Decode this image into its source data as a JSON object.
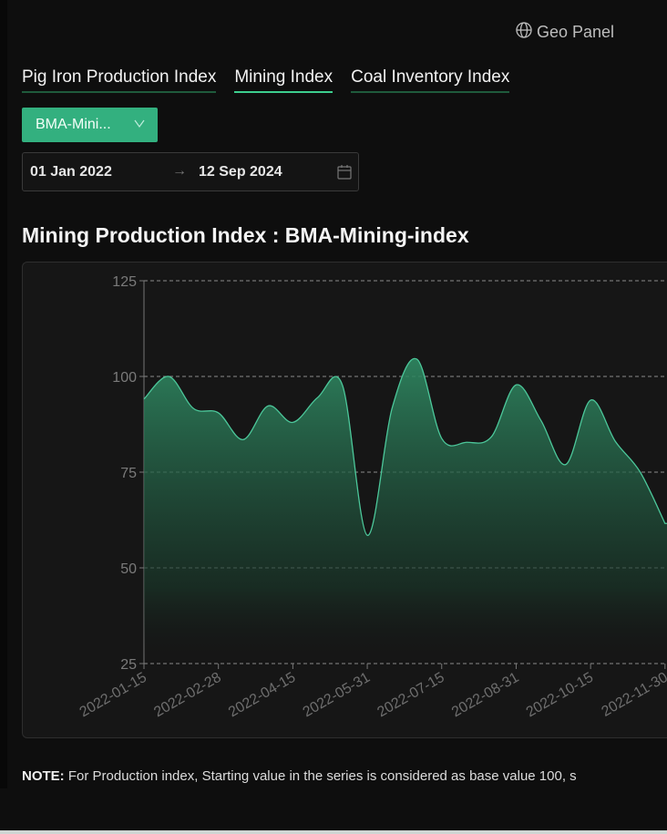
{
  "header": {
    "geo_panel_label": "Geo Panel",
    "geo_icon": "globe-icon"
  },
  "tabs": [
    {
      "label": "Pig Iron Production Index",
      "active": false
    },
    {
      "label": "Mining Index",
      "active": true
    },
    {
      "label": "Coal Inventory Index",
      "active": false
    }
  ],
  "index_select": {
    "value": "BMA-Mini...",
    "icon": "chevron-down-icon"
  },
  "date_range": {
    "start": "01 Jan 2022",
    "end": "12 Sep 2024",
    "separator": "→",
    "icon": "calendar-icon"
  },
  "chart_title": "Mining Production Index : BMA-Mining-index",
  "colors": {
    "accent": "#33b07f",
    "line": "#4cc79a",
    "tab_active": "#3dcf8e",
    "panel_bg": "#161616"
  },
  "chart_data": {
    "type": "area",
    "x": [
      "2022-01-15",
      "2022-01-31",
      "2022-02-15",
      "2022-02-28",
      "2022-03-15",
      "2022-03-31",
      "2022-04-15",
      "2022-04-30",
      "2022-05-15",
      "2022-05-31",
      "2022-06-15",
      "2022-06-30",
      "2022-07-15",
      "2022-07-31",
      "2022-08-15",
      "2022-08-31",
      "2022-09-15",
      "2022-09-30",
      "2022-10-15",
      "2022-10-31",
      "2022-11-15",
      "2022-11-30"
    ],
    "values": [
      94.1,
      100,
      91.6,
      90.5,
      83.5,
      92.3,
      88,
      94.5,
      97.7,
      58.5,
      91.7,
      104.5,
      83.8,
      82.8,
      84.2,
      97.8,
      88.5,
      77,
      93.8,
      83,
      75,
      61.6
    ],
    "x_ticks": [
      "2022-01-15",
      "2022-02-28",
      "2022-04-15",
      "2022-05-31",
      "2022-07-15",
      "2022-08-31",
      "2022-10-15",
      "2022-11-30"
    ],
    "y_ticks": [
      25,
      50,
      75,
      100,
      125
    ],
    "ylim": [
      25,
      125
    ],
    "grid": "horizontal dashed",
    "smooth": true
  },
  "note": {
    "label": "NOTE:",
    "text": " For Production index, Starting value in the series is considered as base value 100, s"
  }
}
